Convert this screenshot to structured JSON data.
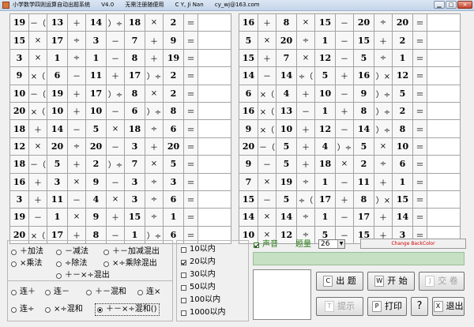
{
  "window": {
    "title": "小学数学四则运算自动出题系统",
    "version": "V4.0",
    "note": "无需注册随便用",
    "author": "C Y, Ji Nan",
    "email": "cy_wj@163.com",
    "close_icon": "×",
    "minimize_icon": "▁",
    "maximize_icon": "□"
  },
  "problems_left": [
    [
      "19",
      "－（",
      "13",
      "＋",
      "14",
      "）÷",
      "18",
      "×",
      "2",
      "＝"
    ],
    [
      "15",
      "×",
      "17",
      "÷",
      "3",
      "－",
      "7",
      "＋",
      "9",
      "＝"
    ],
    [
      "3",
      "×",
      "1",
      "÷",
      "1",
      "－",
      "8",
      "＋",
      "19",
      "＝"
    ],
    [
      "9",
      "×（",
      "6",
      "－",
      "11",
      "＋",
      "17",
      "）÷",
      "2",
      "＝"
    ],
    [
      "10",
      "－（",
      "19",
      "＋",
      "17",
      "）÷",
      "8",
      "×",
      "2",
      "＝"
    ],
    [
      "20",
      "×（",
      "10",
      "＋",
      "10",
      "－",
      "6",
      "）÷",
      "8",
      "＝"
    ],
    [
      "18",
      "＋",
      "14",
      "－",
      "5",
      "×",
      "18",
      "÷",
      "6",
      "＝"
    ],
    [
      "12",
      "×",
      "20",
      "÷",
      "20",
      "－",
      "3",
      "＋",
      "20",
      "＝"
    ],
    [
      "18",
      "－（",
      "5",
      "＋",
      "2",
      "）÷",
      "7",
      "×",
      "5",
      "＝"
    ],
    [
      "16",
      "＋",
      "3",
      "×",
      "9",
      "－",
      "3",
      "÷",
      "3",
      "＝"
    ],
    [
      "3",
      "＋",
      "11",
      "－",
      "4",
      "×",
      "3",
      "÷",
      "6",
      "＝"
    ],
    [
      "19",
      "－",
      "1",
      "×",
      "9",
      "＋",
      "15",
      "÷",
      "1",
      "＝"
    ],
    [
      "20",
      "×（",
      "17",
      "＋",
      "8",
      "－",
      "1",
      "）÷",
      "6",
      "＝"
    ]
  ],
  "problems_right": [
    [
      "16",
      "＋",
      "8",
      "×",
      "15",
      "－",
      "20",
      "÷",
      "20",
      "＝"
    ],
    [
      "5",
      "×",
      "20",
      "÷",
      "1",
      "－",
      "15",
      "＋",
      "2",
      "＝"
    ],
    [
      "15",
      "＋",
      "7",
      "×",
      "12",
      "－",
      "5",
      "÷",
      "1",
      "＝"
    ],
    [
      "14",
      "－",
      "14",
      "÷（",
      "5",
      "＋",
      "16",
      "）×",
      "12",
      "＝"
    ],
    [
      "6",
      "×（",
      "4",
      "＋",
      "10",
      "－",
      "9",
      "）÷",
      "5",
      "＝"
    ],
    [
      "16",
      "×（",
      "13",
      "－",
      "1",
      "＋",
      "8",
      "）÷",
      "2",
      "＝"
    ],
    [
      "9",
      "×（",
      "10",
      "＋",
      "12",
      "－",
      "14",
      "）÷",
      "8",
      "＝"
    ],
    [
      "20",
      "－（",
      "5",
      "＋",
      "4",
      "）÷",
      "5",
      "×",
      "10",
      "＝"
    ],
    [
      "9",
      "－",
      "5",
      "＋",
      "18",
      "×",
      "2",
      "÷",
      "6",
      "＝"
    ],
    [
      "7",
      "×",
      "19",
      "÷",
      "1",
      "－",
      "11",
      "＋",
      "1",
      "＝"
    ],
    [
      "15",
      "－",
      "5",
      "÷（",
      "17",
      "＋",
      "8",
      "）×",
      "15",
      "＝"
    ],
    [
      "14",
      "×",
      "14",
      "÷",
      "1",
      "－",
      "17",
      "＋",
      "14",
      "＝"
    ],
    [
      "10",
      "×",
      "12",
      "÷",
      "5",
      "－",
      "15",
      "＋",
      "3",
      "＝"
    ]
  ],
  "operation_options": {
    "add": "＋加法",
    "subtract": "－减法",
    "add_sub_mix": "＋－加减混出",
    "multiply": "×乘法",
    "divide": "÷除法",
    "mul_div_mix": "×÷乘除混出",
    "all_mix": "＋－×÷混出",
    "chain_add": "连＋",
    "chain_sub": "连－",
    "add_sub_and": "＋－混和",
    "chain_mul": "连×",
    "chain_div": "连÷",
    "mul_div_and": "×÷混和",
    "all_mix_bracket": "＋－×÷混和()"
  },
  "range_options": [
    "10以内",
    "20以内",
    "30以内",
    "50以内",
    "100以内",
    "1000以内"
  ],
  "selected_range_index": 1,
  "sound": {
    "label": "声音",
    "checked": true
  },
  "count": {
    "label": "题量",
    "value": "26",
    "dropdown_icon": "▼"
  },
  "change_color_label": "Change BackColor",
  "buttons": {
    "generate": {
      "key": "C",
      "label": "出 题"
    },
    "start": {
      "key": "W",
      "label": "开 始"
    },
    "submit": {
      "key": "J",
      "label": "交 卷"
    },
    "hint": {
      "key": "T",
      "label": "提示"
    },
    "print": {
      "key": "P",
      "label": "打印"
    },
    "help": {
      "label": "?"
    },
    "exit": {
      "key": "X",
      "label": "退出"
    }
  },
  "colors": {
    "result_bar": "#c5e0c2",
    "accent_green": "#2a7a1a",
    "change_color_text": "#d40000"
  }
}
